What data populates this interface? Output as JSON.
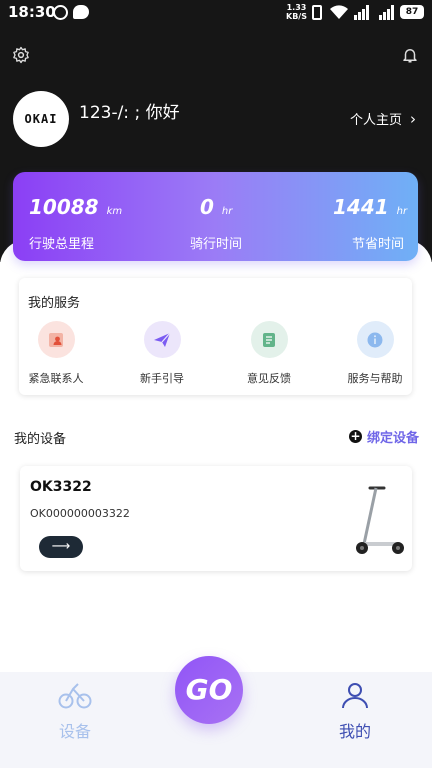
{
  "status_bar": {
    "time": "18:30",
    "speed_value": "1.33",
    "speed_unit": "KB/S",
    "battery": "87",
    "network": "4G"
  },
  "header": {
    "greeting": "123-/: ; 你好",
    "profile_link": "个人主页",
    "avatar_text": "OKAI"
  },
  "stats": [
    {
      "value": "10088",
      "unit": "km",
      "label": "行驶总里程"
    },
    {
      "value": "0",
      "unit": "hr",
      "label": "骑行时间"
    },
    {
      "value": "1441",
      "unit": "hr",
      "label": "节省时间"
    }
  ],
  "services": {
    "title": "我的服务",
    "items": [
      {
        "label": "紧急联系人",
        "icon": "emergency-contact-icon",
        "color": "#fbe3df"
      },
      {
        "label": "新手引导",
        "icon": "paper-plane-icon",
        "color": "#ece6fb"
      },
      {
        "label": "意见反馈",
        "icon": "feedback-note-icon",
        "color": "#e3f1ea"
      },
      {
        "label": "服务与帮助",
        "icon": "info-icon",
        "color": "#e0ecfa"
      }
    ]
  },
  "devices": {
    "title": "我的设备",
    "bind_label": "绑定设备",
    "items": [
      {
        "name": "OK3322",
        "serial": "OK000000003322"
      }
    ]
  },
  "bottom_nav": {
    "devices_label": "设备",
    "go_label": "GO",
    "mine_label": "我的"
  },
  "colors": {
    "accent": "#7067e8",
    "nav_active": "#3e4eb2",
    "nav_inactive": "#a8c1ec"
  }
}
